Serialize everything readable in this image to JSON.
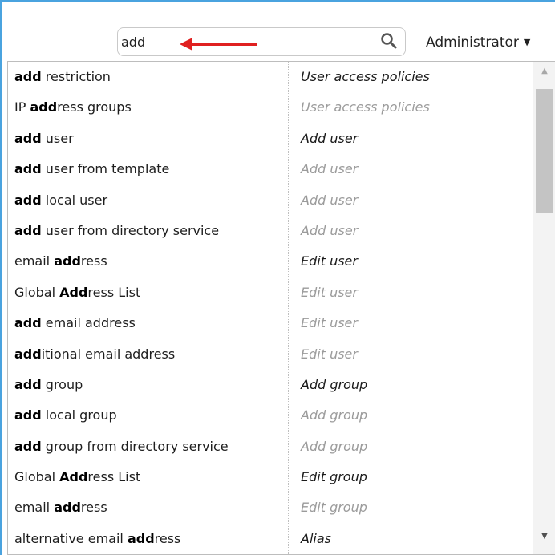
{
  "search": {
    "value": "add"
  },
  "user_menu": {
    "label": "Administrator",
    "caret": "▼"
  },
  "icons": {
    "search": "search-icon",
    "arrow": "red-arrow-annotation",
    "caret": "chevron-down-icon"
  },
  "colors": {
    "accent_border": "#4aa3df",
    "arrow": "#e02020"
  },
  "results": [
    {
      "parts": [
        {
          "t": "add",
          "b": true
        },
        {
          "t": " restriction",
          "b": false
        }
      ],
      "category": "User access policies",
      "primary": true
    },
    {
      "parts": [
        {
          "t": "IP ",
          "b": false
        },
        {
          "t": "add",
          "b": true
        },
        {
          "t": "ress groups",
          "b": false
        }
      ],
      "category": "User access policies",
      "primary": false
    },
    {
      "parts": [
        {
          "t": "add",
          "b": true
        },
        {
          "t": " user",
          "b": false
        }
      ],
      "category": "Add user",
      "primary": true
    },
    {
      "parts": [
        {
          "t": "add",
          "b": true
        },
        {
          "t": " user from template",
          "b": false
        }
      ],
      "category": "Add user",
      "primary": false
    },
    {
      "parts": [
        {
          "t": "add",
          "b": true
        },
        {
          "t": " local user",
          "b": false
        }
      ],
      "category": "Add user",
      "primary": false
    },
    {
      "parts": [
        {
          "t": "add",
          "b": true
        },
        {
          "t": " user from directory service",
          "b": false
        }
      ],
      "category": "Add user",
      "primary": false
    },
    {
      "parts": [
        {
          "t": "email ",
          "b": false
        },
        {
          "t": "add",
          "b": true
        },
        {
          "t": "ress",
          "b": false
        }
      ],
      "category": "Edit user",
      "primary": true
    },
    {
      "parts": [
        {
          "t": "Global ",
          "b": false
        },
        {
          "t": "Add",
          "b": true
        },
        {
          "t": "ress List",
          "b": false
        }
      ],
      "category": "Edit user",
      "primary": false
    },
    {
      "parts": [
        {
          "t": "add",
          "b": true
        },
        {
          "t": " email address",
          "b": false
        }
      ],
      "category": "Edit user",
      "primary": false
    },
    {
      "parts": [
        {
          "t": "add",
          "b": true
        },
        {
          "t": "itional email address",
          "b": false
        }
      ],
      "category": "Edit user",
      "primary": false
    },
    {
      "parts": [
        {
          "t": "add",
          "b": true
        },
        {
          "t": " group",
          "b": false
        }
      ],
      "category": "Add group",
      "primary": true
    },
    {
      "parts": [
        {
          "t": "add",
          "b": true
        },
        {
          "t": " local group",
          "b": false
        }
      ],
      "category": "Add group",
      "primary": false
    },
    {
      "parts": [
        {
          "t": "add",
          "b": true
        },
        {
          "t": " group from directory service",
          "b": false
        }
      ],
      "category": "Add group",
      "primary": false
    },
    {
      "parts": [
        {
          "t": "Global ",
          "b": false
        },
        {
          "t": "Add",
          "b": true
        },
        {
          "t": "ress List",
          "b": false
        }
      ],
      "category": "Edit group",
      "primary": true
    },
    {
      "parts": [
        {
          "t": "email ",
          "b": false
        },
        {
          "t": "add",
          "b": true
        },
        {
          "t": "ress",
          "b": false
        }
      ],
      "category": "Edit group",
      "primary": false
    },
    {
      "parts": [
        {
          "t": "alternative email ",
          "b": false
        },
        {
          "t": "add",
          "b": true
        },
        {
          "t": "ress",
          "b": false
        }
      ],
      "category": "Alias",
      "primary": true
    }
  ]
}
